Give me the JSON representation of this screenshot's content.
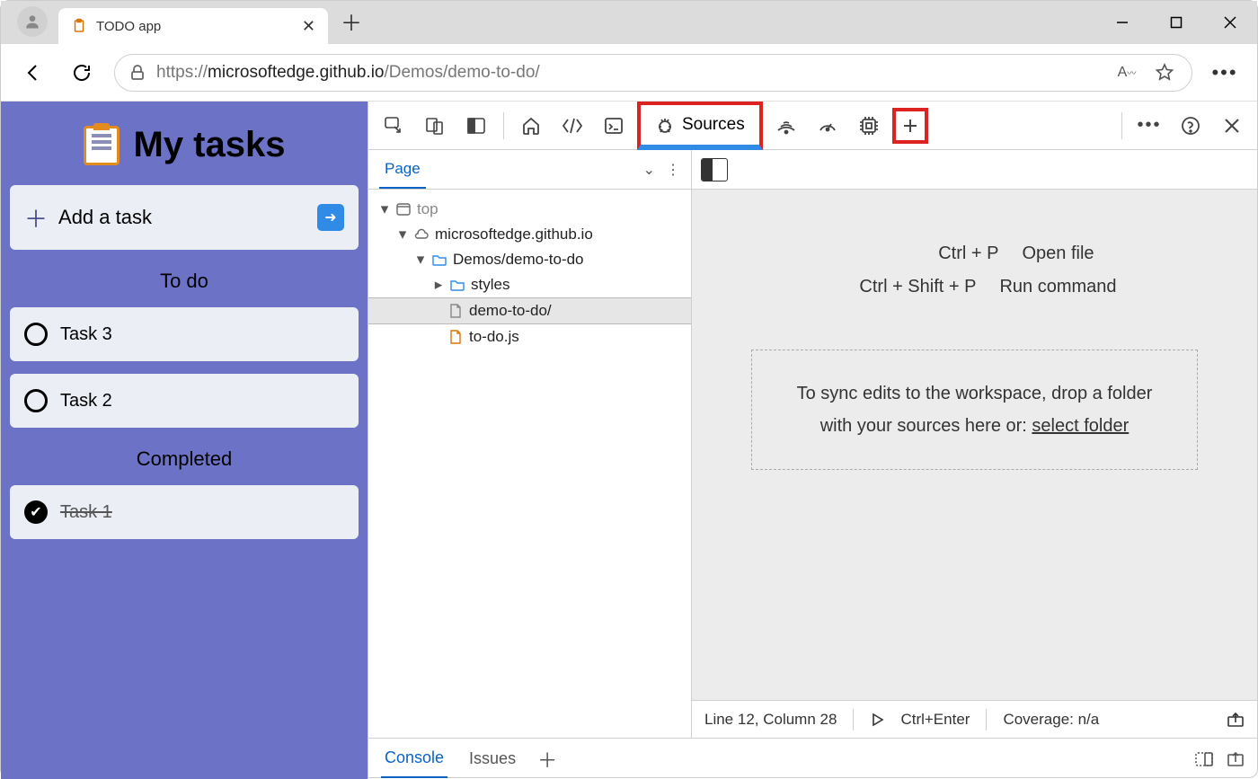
{
  "browser": {
    "tab_title": "TODO app",
    "url_scheme": "https://",
    "url_host": "microsoftedge.github.io",
    "url_path": "/Demos/demo-to-do/"
  },
  "app": {
    "title": "My tasks",
    "add_placeholder": "Add a task",
    "section_todo": "To do",
    "section_done": "Completed",
    "tasks_todo": [
      "Task 3",
      "Task 2"
    ],
    "tasks_done": [
      "Task 1"
    ]
  },
  "devtools": {
    "active_tab": "Sources",
    "page_tab": "Page",
    "tree": {
      "top": "top",
      "host": "microsoftedge.github.io",
      "folder": "Demos/demo-to-do",
      "styles": "styles",
      "index": "demo-to-do/",
      "js": "to-do.js"
    },
    "placeholder": {
      "open_k": "Ctrl + P",
      "open_l": "Open file",
      "cmd_k": "Ctrl + Shift + P",
      "cmd_l": "Run command",
      "drop1": "To sync edits to the workspace, drop a folder",
      "drop2": "with your sources here or: ",
      "drop_link": "select folder"
    },
    "status": {
      "pos": "Line 12, Column 28",
      "run": "Ctrl+Enter",
      "cov": "Coverage: n/a"
    },
    "drawer": {
      "console": "Console",
      "issues": "Issues"
    }
  }
}
